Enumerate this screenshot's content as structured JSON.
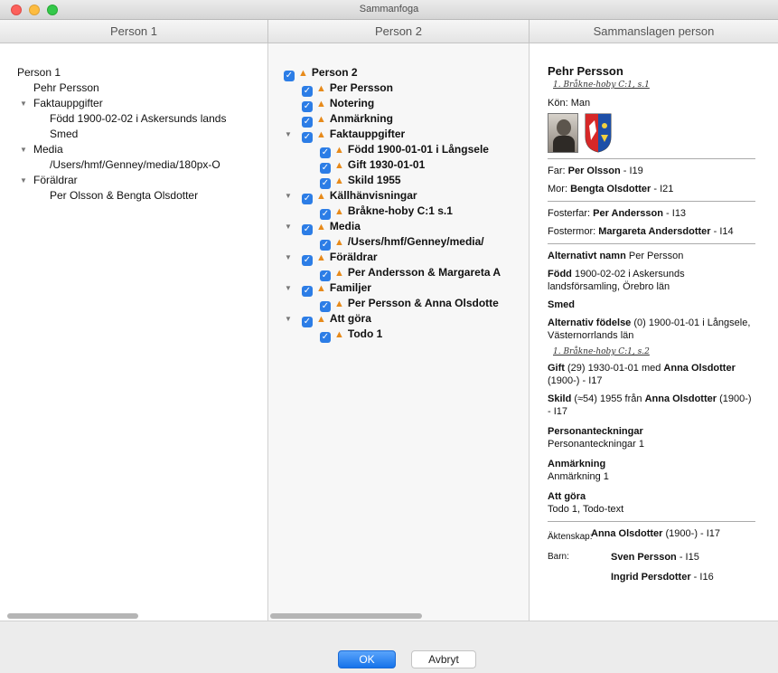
{
  "window": {
    "title": "Sammanfoga"
  },
  "columns": [
    "Person 1",
    "Person 2",
    "Sammanslagen person"
  ],
  "person1_tree": [
    {
      "label": "Person 1",
      "indent": 0,
      "disc": ""
    },
    {
      "label": "Pehr Persson",
      "indent": 1,
      "disc": ""
    },
    {
      "label": "Faktauppgifter",
      "indent": 1,
      "disc": "▼"
    },
    {
      "label": "Född 1900-02-02 i Askersunds lands",
      "indent": 2,
      "disc": ""
    },
    {
      "label": "Smed",
      "indent": 2,
      "disc": ""
    },
    {
      "label": "Media",
      "indent": 1,
      "disc": "▼"
    },
    {
      "label": "/Users/hmf/Genney/media/180px-O",
      "indent": 2,
      "disc": ""
    },
    {
      "label": "Föräldrar",
      "indent": 1,
      "disc": "▼"
    },
    {
      "label": "Per Olsson & Bengta Olsdotter",
      "indent": 2,
      "disc": ""
    }
  ],
  "person2_tree": [
    {
      "label": "Person 2",
      "indent": 0,
      "disc": ""
    },
    {
      "label": "Per Persson",
      "indent": 1,
      "disc": ""
    },
    {
      "label": "Notering",
      "indent": 1,
      "disc": ""
    },
    {
      "label": "Anmärkning",
      "indent": 1,
      "disc": ""
    },
    {
      "label": "Faktauppgifter",
      "indent": 1,
      "disc": "▼"
    },
    {
      "label": "Född 1900-01-01 i Långsele",
      "indent": 2,
      "disc": ""
    },
    {
      "label": "Gift 1930-01-01",
      "indent": 2,
      "disc": ""
    },
    {
      "label": "Skild 1955",
      "indent": 2,
      "disc": ""
    },
    {
      "label": "Källhänvisningar",
      "indent": 1,
      "disc": "▼"
    },
    {
      "label": "Bråkne-hoby C:1 s.1",
      "indent": 2,
      "disc": ""
    },
    {
      "label": "Media",
      "indent": 1,
      "disc": "▼"
    },
    {
      "label": "/Users/hmf/Genney/media/",
      "indent": 2,
      "disc": ""
    },
    {
      "label": "Föräldrar",
      "indent": 1,
      "disc": "▼"
    },
    {
      "label": "Per Andersson & Margareta A",
      "indent": 2,
      "disc": ""
    },
    {
      "label": "Familjer",
      "indent": 1,
      "disc": "▼"
    },
    {
      "label": "Per Persson & Anna Olsdotte",
      "indent": 2,
      "disc": ""
    },
    {
      "label": "Att göra",
      "indent": 1,
      "disc": "▼"
    },
    {
      "label": "Todo 1",
      "indent": 2,
      "disc": ""
    }
  ],
  "merged": {
    "name": "Pehr Persson",
    "source1": "1.  Bråkne-hoby C:1, s.1",
    "gender_label": "Kön:",
    "gender": "Man",
    "father_label": "Far:",
    "father": "Per Olsson",
    "father_id": " - I19",
    "mother_label": "Mor:",
    "mother": "Bengta Olsdotter",
    "mother_id": " - I21",
    "foster_father_label": "Fosterfar:",
    "foster_father": "Per Andersson",
    "foster_father_id": " - I13",
    "foster_mother_label": "Fostermor:",
    "foster_mother": "Margareta Andersdotter",
    "foster_mother_id": " - I14",
    "alt_name_label": "Alternativt namn",
    "alt_name": "Per Persson",
    "born_label": "Född",
    "born": "1900-02-02 i Askersunds landsförsamling, Örebro län",
    "occupation": "Smed",
    "alt_birth_label": "Alternativ födelse",
    "alt_birth": "(0) 1900-01-01 i Långsele, Västernorrlands län",
    "source2": "1.  Bråkne-hoby C:1, s.2",
    "married_label": "Gift",
    "married_text": "(29) 1930-01-01 med",
    "married_spouse": "Anna Olsdotter",
    "married_spouse_rest": "(1900-) - I17",
    "divorced_label": "Skild",
    "divorced_text": "(≈54) 1955 från",
    "divorced_spouse": "Anna Olsdotter",
    "divorced_spouse_rest": "(1900-) - I17",
    "notes_label": "Personanteckningar",
    "notes": "Personanteckningar 1",
    "remark_label": "Anmärkning",
    "remark": "Anmärkning 1",
    "todo_label": "Att göra",
    "todo": "Todo 1, Todo-text",
    "marriage_label": "Äktenskap:",
    "marriage_spouse": "Anna Olsdotter",
    "marriage_rest": "(1900-) - I17",
    "children_label": "Barn:",
    "child1": "Sven Persson",
    "child1_id": " - I15",
    "child2": "Ingrid Persdotter",
    "child2_id": " - I16"
  },
  "buttons": {
    "ok": "OK",
    "cancel": "Avbryt"
  },
  "colors": {
    "accent": "#2c7de6",
    "warning": "#e78a1a"
  }
}
